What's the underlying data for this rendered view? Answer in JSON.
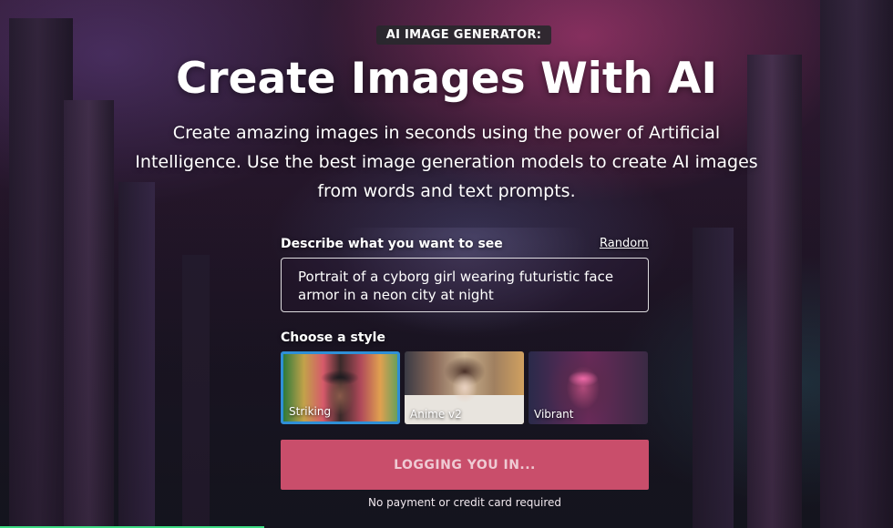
{
  "hero": {
    "badge": "AI IMAGE GENERATOR:",
    "title": "Create Images With AI",
    "subtitle": "Create amazing images in seconds using the power of Artificial Intelligence. Use the best image generation models to create AI images from words and text prompts."
  },
  "prompt": {
    "label": "Describe what you want to see",
    "random_link": "Random",
    "value": "Portrait of a cyborg girl wearing futuristic face armor in a neon city at night"
  },
  "styles": {
    "label": "Choose a style",
    "items": [
      {
        "name": "Striking",
        "selected": true
      },
      {
        "name": "Anime v2",
        "selected": false
      },
      {
        "name": "Vibrant",
        "selected": false
      }
    ]
  },
  "cta": {
    "label": "LOGGING YOU IN...",
    "note": "No payment or credit card required"
  },
  "colors": {
    "cta_background": "#c94e6b",
    "selected_border": "#2f8fd6",
    "progress_bar": "#3ddc84"
  }
}
